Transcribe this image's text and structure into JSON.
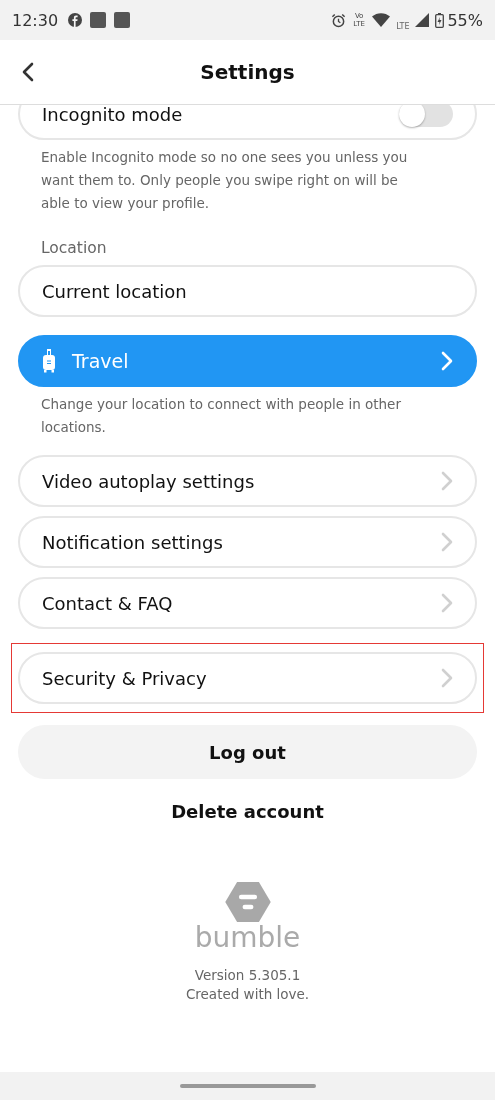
{
  "status_bar": {
    "time": "12:30",
    "volte": "Vo LTE",
    "lte": "LTE",
    "battery": "55%"
  },
  "header": {
    "title": "Settings"
  },
  "incognito": {
    "label": "Incognito mode",
    "on": false,
    "description": "Enable Incognito mode so no one sees you unless you want them to. Only people you swipe right on will be able to view your profile."
  },
  "location": {
    "heading": "Location",
    "current": "Current location",
    "travel": "Travel",
    "travel_description": "Change your location to connect with people in other locations."
  },
  "menu_items": [
    {
      "label": "Video autoplay settings",
      "highlighted": false
    },
    {
      "label": "Notification settings",
      "highlighted": false
    },
    {
      "label": "Contact & FAQ",
      "highlighted": false
    },
    {
      "label": "Security & Privacy",
      "highlighted": true
    }
  ],
  "logout": "Log out",
  "delete_account": "Delete account",
  "footer": {
    "brand": "bumble",
    "version": "Version 5.305.1",
    "tagline": "Created with love."
  }
}
